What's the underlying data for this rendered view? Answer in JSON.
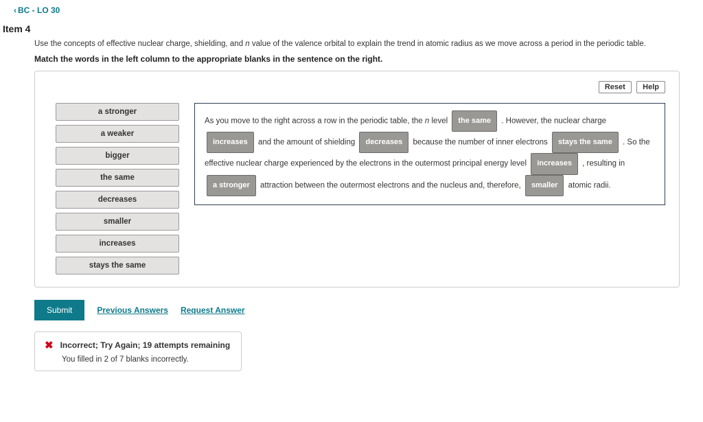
{
  "nav": {
    "back_label": "BC - LO 30"
  },
  "item": {
    "title": "Item 4",
    "instruction1_pre": "Use the concepts of effective nuclear charge, shielding, and ",
    "instruction1_n": "n",
    "instruction1_post": " value of the valence orbital to explain the trend in atomic radius as we move across a period in the periodic table.",
    "instruction2": "Match the words in the left column to the appropriate blanks in the sentence on the right."
  },
  "buttons": {
    "reset": "Reset",
    "help": "Help",
    "submit": "Submit",
    "prev_answers": "Previous Answers",
    "request_answer": "Request Answer"
  },
  "words": [
    "a stronger",
    "a weaker",
    "bigger",
    "the same",
    "decreases",
    "smaller",
    "increases",
    "stays the same"
  ],
  "sentence": {
    "p1": "As you move to the right across a row in the periodic table, the ",
    "n": "n",
    "p2": " level ",
    "b1": "the same",
    "p3": " . However, the nuclear charge ",
    "b2": "increases",
    "p4": " and the amount of shielding ",
    "b3": "decreases",
    "p5": " because the number of inner electrons ",
    "b4": "stays the same",
    "p6": " . So the effective nuclear charge experienced by the electrons in the outermost principal energy level ",
    "b5": "increases",
    "p7": " , resulting in ",
    "b6": "a stronger",
    "p8": " attraction between the outermost electrons and the nucleus and, therefore, ",
    "b7": "smaller",
    "p9": " atomic radii."
  },
  "feedback": {
    "heading": "Incorrect; Try Again; 19 attempts remaining",
    "detail": "You filled in 2 of 7 blanks incorrectly."
  }
}
